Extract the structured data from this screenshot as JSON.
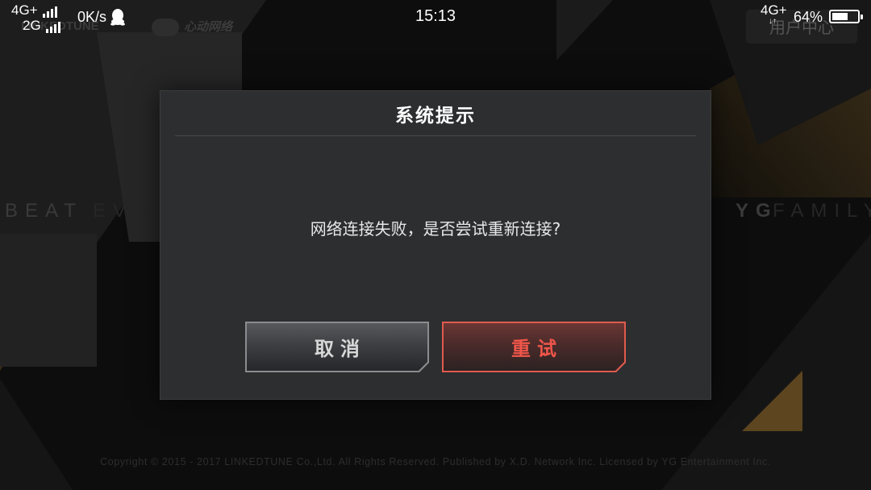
{
  "status_bar": {
    "sim1_network": "4G+",
    "sim2_network": "2G",
    "net_speed": "0K/s",
    "time": "15:13",
    "right_network": "4G+",
    "battery_percent": "64%",
    "battery_level": 0.64
  },
  "background": {
    "brand_linkedtune": "LINKEDTUNE",
    "brand_xd": "心动网络",
    "user_center_label": "用户中心",
    "text_beat": "BEAT",
    "text_evo": "EVO",
    "text_yg": "YG",
    "text_family": "FAMILY",
    "copyright": "Copyright © 2015 - 2017 LINKEDTUNE Co.,Ltd. All Rights Reserved. Published by X.D. Network Inc. Licensed by YG Entertainment Inc."
  },
  "dialog": {
    "title": "系统提示",
    "message": "网络连接失败，是否尝试重新连接?",
    "cancel_label": "取消",
    "retry_label": "重试"
  },
  "colors": {
    "dialog_bg": "#2d2e30",
    "retry_accent": "#e05a4e",
    "gold_accent": "#8a6a2e"
  },
  "icons": [
    "qq-penguin-icon",
    "battery-icon",
    "signal-bars-icon"
  ]
}
